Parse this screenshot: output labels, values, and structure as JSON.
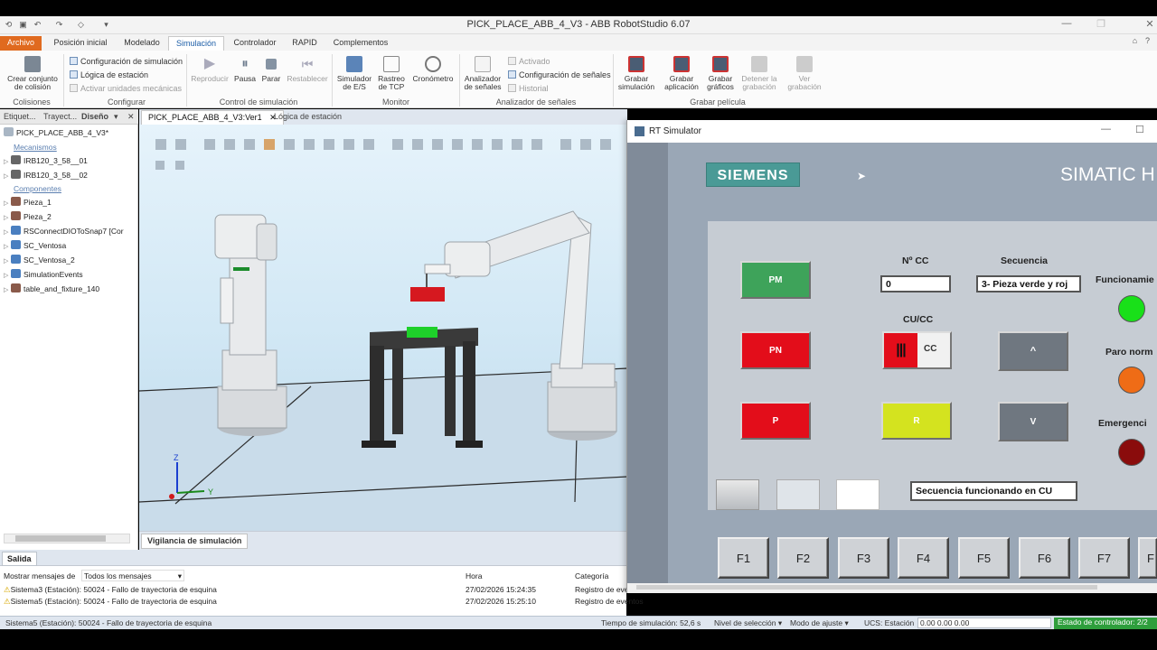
{
  "app": {
    "title": "PICK_PLACE_ABB_4_V3 - ABB RobotStudio 6.07"
  },
  "ribbon_tabs": [
    "Archivo",
    "Posición inicial",
    "Modelado",
    "Simulación",
    "Controlador",
    "RAPID",
    "Complementos"
  ],
  "ribbon": {
    "colisiones": {
      "btn": "Crear conjunto de colisión",
      "btn_l1": "Crear conjunto",
      "btn_l2": "de colisión",
      "group": "Colisiones"
    },
    "configurar": {
      "items": [
        "Configuración de simulación",
        "Lógica de estación",
        "Activar unidades mecánicas"
      ],
      "group": "Configurar"
    },
    "control": {
      "buttons": [
        "Reproducir",
        "Pausa",
        "Parar",
        "Restablecer"
      ],
      "group": "Control de simulación"
    },
    "monitor": {
      "b1_l1": "Simulador",
      "b1_l2": "de E/S",
      "b2_l1": "Rastreo",
      "b2_l2": "de TCP",
      "b3_l1": "Cronómetro",
      "group": "Monitor"
    },
    "analizador": {
      "b_l1": "Analizador",
      "b_l2": "de señales",
      "items": [
        "Activado",
        "Configuración de señales",
        "Historial"
      ],
      "group": "Analizador de señales"
    },
    "grabar": {
      "b1_l1": "Grabar",
      "b1_l2": "simulación",
      "b2_l1": "Grabar",
      "b2_l2": "aplicación",
      "b3_l1": "Grabar",
      "b3_l2": "gráficos",
      "b4_l1": "Detener la",
      "b4_l2": "grabación",
      "b5_l1": "Ver",
      "b5_l2": "grabación",
      "group": "Grabar película"
    }
  },
  "left_panel": {
    "tabs": [
      "Etiquet...",
      "Trayect...",
      "Diseño"
    ],
    "root": "PICK_PLACE_ABB_4_V3*",
    "mecanismos_label": "Mecanismos",
    "mecanismos": [
      "IRB120_3_58__01",
      "IRB120_3_58__02"
    ],
    "componentes_label": "Componentes",
    "componentes": [
      "Pieza_1",
      "Pieza_2",
      "RSConnectDIOToSnap7 [Cor",
      "SC_Ventosa",
      "SC_Ventosa_2",
      "SimulationEvents",
      "table_and_fixture_140"
    ]
  },
  "doc_tabs": [
    "PICK_PLACE_ABB_4_V3:Ver1",
    "Lógica de estación"
  ],
  "viewport_footer": "Vigilancia de simulación",
  "axes": {
    "z": "Z",
    "y": "Y"
  },
  "output": {
    "tab": "Salida",
    "filter_label": "Mostrar mensajes de",
    "filter_value": "Todos los mensajes",
    "col_hora": "Hora",
    "col_categoria": "Categoría",
    "rows": [
      {
        "msg": "Sistema3 (Estación): 50024 - Fallo de trayectoria de esquina",
        "hora": "27/02/2026 15:24:35",
        "cat": "Registro de eve"
      },
      {
        "msg": "Sistema5 (Estación): 50024 - Fallo de trayectoria de esquina",
        "hora": "27/02/2026 15:25:10",
        "cat": "Registro de eventos"
      }
    ]
  },
  "status": {
    "message": "Sistema5 (Estación): 50024 - Fallo de trayectoria de esquina",
    "sim_time": "Tiempo de simulación: 52,6 s",
    "selection": "Nivel de selección",
    "snap": "Modo de ajuste",
    "ucs": "UCS: Estación",
    "coords": "0.00  0.00  0.00",
    "controller": "Estado de controlador: 2/2"
  },
  "rt": {
    "title": "RT Simulator",
    "brand": "SIEMENS",
    "product": "SIMATIC H",
    "nocc_label": "Nº CC",
    "nocc_value": "0",
    "sec_label": "Secuencia",
    "sec_value": "3- Pieza verde y roj",
    "cucc_label": "CU/CC",
    "cc_label": "CC",
    "buttons": {
      "pm": "PM",
      "pn": "PN",
      "p": "P",
      "r": "R",
      "up": "^",
      "v": "V"
    },
    "lamps": {
      "func": "Funcionamie",
      "paro": "Paro norm",
      "emer": "Emergenci"
    },
    "status_field": "Secuencia funcionando en CU",
    "fkeys": [
      "F1",
      "F2",
      "F3",
      "F4",
      "F5",
      "F6",
      "F7",
      "F"
    ]
  },
  "colors": {
    "file_tab": "#e06a1f",
    "pm": "#3ea35a",
    "red": "#e30d1a",
    "yellow": "#d4e31f",
    "gray_btn": "#6f7780",
    "lamp_green": "#19e019",
    "lamp_orange": "#ef6c16",
    "lamp_red": "#8a0c0c"
  }
}
